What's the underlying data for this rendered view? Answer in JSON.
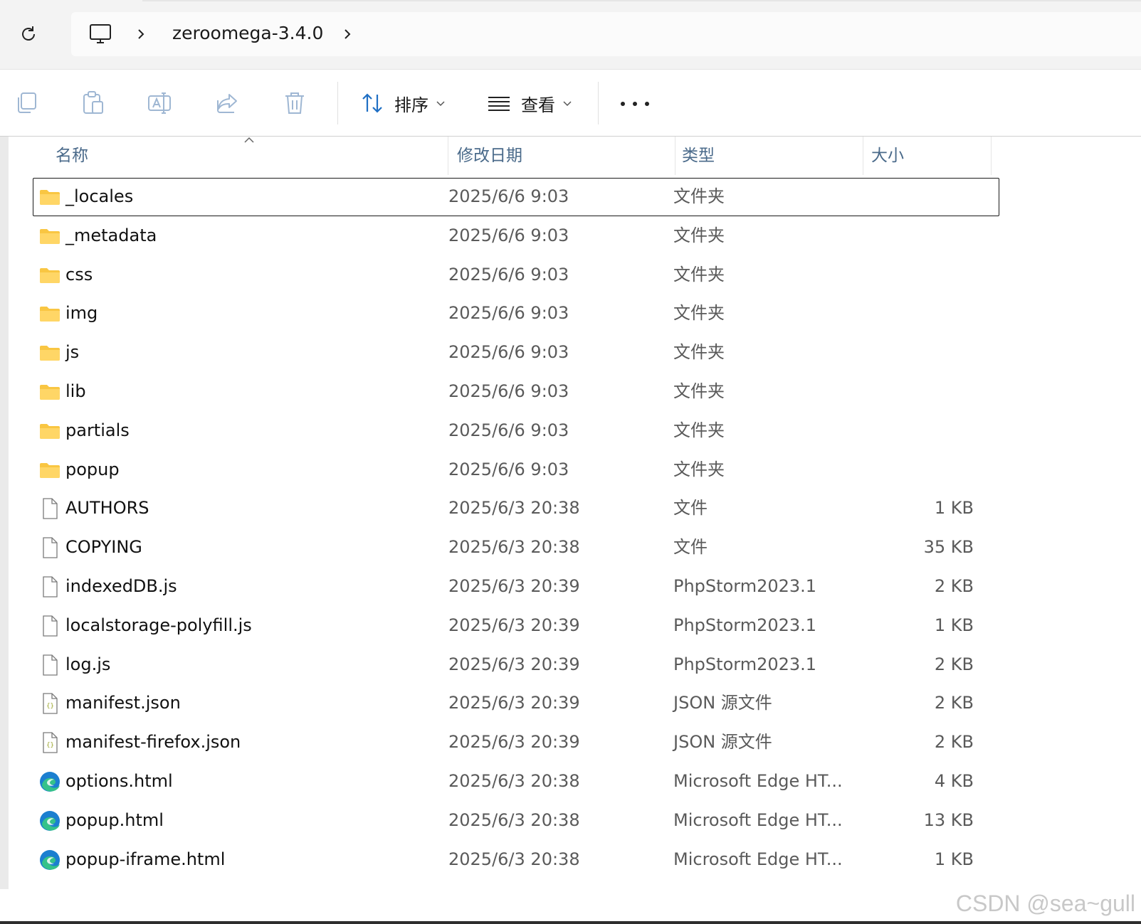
{
  "address_bar": {
    "breadcrumbs": [
      "zeroomega-3.4.0"
    ]
  },
  "toolbar": {
    "sort_label": "排序",
    "view_label": "查看"
  },
  "columns": {
    "name": "名称",
    "date": "修改日期",
    "type": "类型",
    "size": "大小"
  },
  "files": [
    {
      "name": "_locales",
      "date": "2025/6/6 9:03",
      "type": "文件夹",
      "size": "",
      "icon": "folder-icon",
      "selected": true
    },
    {
      "name": "_metadata",
      "date": "2025/6/6 9:03",
      "type": "文件夹",
      "size": "",
      "icon": "folder-icon"
    },
    {
      "name": "css",
      "date": "2025/6/6 9:03",
      "type": "文件夹",
      "size": "",
      "icon": "folder-icon"
    },
    {
      "name": "img",
      "date": "2025/6/6 9:03",
      "type": "文件夹",
      "size": "",
      "icon": "folder-icon"
    },
    {
      "name": "js",
      "date": "2025/6/6 9:03",
      "type": "文件夹",
      "size": "",
      "icon": "folder-icon"
    },
    {
      "name": "lib",
      "date": "2025/6/6 9:03",
      "type": "文件夹",
      "size": "",
      "icon": "folder-icon"
    },
    {
      "name": "partials",
      "date": "2025/6/6 9:03",
      "type": "文件夹",
      "size": "",
      "icon": "folder-icon"
    },
    {
      "name": "popup",
      "date": "2025/6/6 9:03",
      "type": "文件夹",
      "size": "",
      "icon": "folder-icon"
    },
    {
      "name": "AUTHORS",
      "date": "2025/6/3 20:38",
      "type": "文件",
      "size": "1 KB",
      "icon": "file-icon"
    },
    {
      "name": "COPYING",
      "date": "2025/6/3 20:38",
      "type": "文件",
      "size": "35 KB",
      "icon": "file-icon"
    },
    {
      "name": "indexedDB.js",
      "date": "2025/6/3 20:39",
      "type": "PhpStorm2023.1",
      "size": "2 KB",
      "icon": "file-icon"
    },
    {
      "name": "localstorage-polyfill.js",
      "date": "2025/6/3 20:39",
      "type": "PhpStorm2023.1",
      "size": "1 KB",
      "icon": "file-icon"
    },
    {
      "name": "log.js",
      "date": "2025/6/3 20:39",
      "type": "PhpStorm2023.1",
      "size": "2 KB",
      "icon": "file-icon"
    },
    {
      "name": "manifest.json",
      "date": "2025/6/3 20:39",
      "type": "JSON 源文件",
      "size": "2 KB",
      "icon": "json-file-icon"
    },
    {
      "name": "manifest-firefox.json",
      "date": "2025/6/3 20:39",
      "type": "JSON 源文件",
      "size": "2 KB",
      "icon": "json-file-icon"
    },
    {
      "name": "options.html",
      "date": "2025/6/3 20:38",
      "type": "Microsoft Edge HT...",
      "size": "4 KB",
      "icon": "edge-icon"
    },
    {
      "name": "popup.html",
      "date": "2025/6/3 20:38",
      "type": "Microsoft Edge HT...",
      "size": "13 KB",
      "icon": "edge-icon"
    },
    {
      "name": "popup-iframe.html",
      "date": "2025/6/3 20:38",
      "type": "Microsoft Edge HT...",
      "size": "1 KB",
      "icon": "edge-icon"
    }
  ],
  "watermark": "CSDN @sea~gull",
  "colors": {
    "folder": "#f9c642",
    "edge_blue": "#1b7fd0",
    "edge_green": "#35c28a",
    "header_text": "#4a6a8a"
  }
}
